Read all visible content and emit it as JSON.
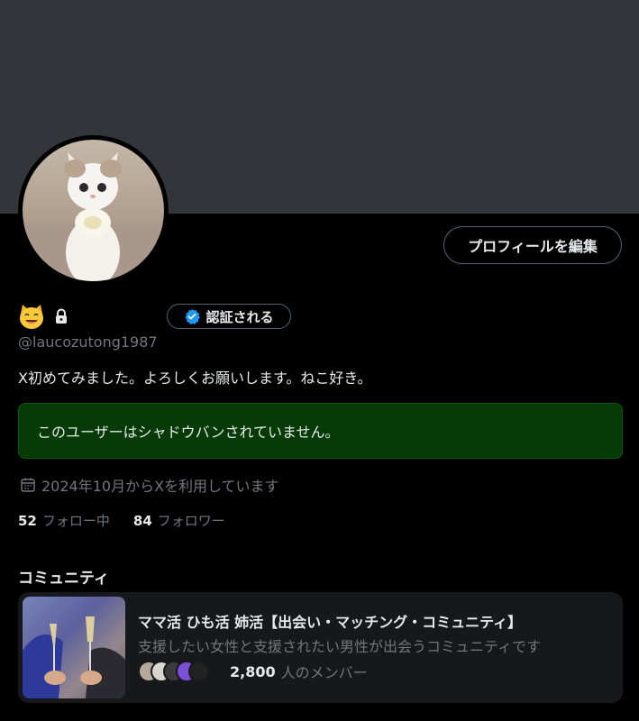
{
  "profile": {
    "name_emoji_icon": "smiling-cat-face-emoji",
    "lock_icon": "lock-icon",
    "handle": "@laucozutong1987",
    "bio": "X初めてみました。よろしくお願いします。ねこ好き。",
    "edit_profile_label": "プロフィールを編集",
    "verify_label": "認証される",
    "joined": "2024年10月からXを利用しています",
    "following_count": "52",
    "following_label": "フォロー中",
    "followers_count": "84",
    "followers_label": "フォロワー"
  },
  "shadowban_notice": "このユーザーはシャドウバンされていません。",
  "community": {
    "heading": "コミュニティ",
    "title": "ママ活 ひも活 姉活【出会い・マッチング・コミュニティ】",
    "description": "支援したい女性と支援されたい男性が出会うコミュニティです",
    "member_count": "2,800",
    "member_label": "人のメンバー"
  },
  "colors": {
    "background": "#000000",
    "banner": "#32353a",
    "notice_bg": "#063a06",
    "verified_blue": "#1d9bf0",
    "muted_text": "#71767b"
  }
}
